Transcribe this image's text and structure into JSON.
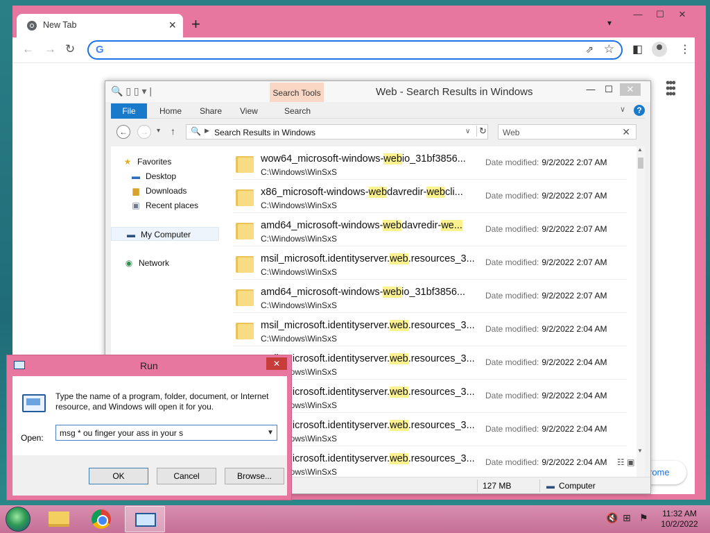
{
  "chrome": {
    "tab_title": "New Tab",
    "new_tab_symbol": "+",
    "customize_label": "rome",
    "omnibox_value": "",
    "icons": [
      "back-icon",
      "forward-icon",
      "reload-icon",
      "google-g-icon",
      "share-icon",
      "star-icon",
      "side-panel-icon",
      "profile-icon",
      "menu-icon",
      "apps-grid-icon"
    ]
  },
  "explorer": {
    "title": "Web - Search Results in Windows",
    "context_tab": "Search Tools",
    "ribbon_tabs": [
      "File",
      "Home",
      "Share",
      "View",
      "Search"
    ],
    "address_path": "Search Results in Windows",
    "search_value": "Web",
    "nav": {
      "favorites": "Favorites",
      "desktop": "Desktop",
      "downloads": "Downloads",
      "recent": "Recent places",
      "computer": "My Computer",
      "network": "Network"
    },
    "date_label": "Date modified:",
    "results": [
      {
        "pre": "wow64_microsoft-windows-",
        "hl": "web",
        "post": "io_31bf3856...",
        "hl2": "",
        "post2": "",
        "loc": "C:\\Windows\\WinSxS",
        "date": "9/2/2022 2:07 AM"
      },
      {
        "pre": "x86_microsoft-windows-",
        "hl": "web",
        "post": "davredir-",
        "hl2": "web",
        "post2": "cli...",
        "loc": "C:\\Windows\\WinSxS",
        "date": "9/2/2022 2:07 AM"
      },
      {
        "pre": "amd64_microsoft-windows-",
        "hl": "web",
        "post": "davredir-",
        "hl2": "we...",
        "post2": "",
        "loc": "C:\\Windows\\WinSxS",
        "date": "9/2/2022 2:07 AM"
      },
      {
        "pre": "msil_microsoft.identityserver.",
        "hl": "web",
        "post": ".resources_3...",
        "hl2": "",
        "post2": "",
        "loc": "C:\\Windows\\WinSxS",
        "date": "9/2/2022 2:07 AM"
      },
      {
        "pre": "amd64_microsoft-windows-",
        "hl": "web",
        "post": "io_31bf3856...",
        "hl2": "",
        "post2": "",
        "loc": "C:\\Windows\\WinSxS",
        "date": "9/2/2022 2:07 AM"
      },
      {
        "pre": "msil_microsoft.identityserver.",
        "hl": "web",
        "post": ".resources_3...",
        "hl2": "",
        "post2": "",
        "loc": "C:\\Windows\\WinSxS",
        "date": "9/2/2022 2:04 AM"
      },
      {
        "pre": "msil_microsoft.identityserver.",
        "hl": "web",
        "post": ".resources_3...",
        "hl2": "",
        "post2": "",
        "loc": "C:\\Windows\\WinSxS",
        "date": "9/2/2022 2:04 AM"
      },
      {
        "pre": "msil_microsoft.identityserver.",
        "hl": "web",
        "post": ".resources_3...",
        "hl2": "",
        "post2": "",
        "loc": "C:\\Windows\\WinSxS",
        "date": "9/2/2022 2:04 AM"
      },
      {
        "pre": "msil_microsoft.identityserver.",
        "hl": "web",
        "post": ".resources_3...",
        "hl2": "",
        "post2": "",
        "loc": "C:\\Windows\\WinSxS",
        "date": "9/2/2022 2:04 AM"
      },
      {
        "pre": "msil_microsoft.identityserver.",
        "hl": "web",
        "post": ".resources_3...",
        "hl2": "",
        "post2": "",
        "loc": "C:\\Windows\\WinSxS",
        "date": "9/2/2022 2:04 AM"
      }
    ],
    "status_size": "127 MB",
    "status_location": "Computer"
  },
  "run": {
    "title": "Run",
    "description": "Type the name of a program, folder, document, or Internet resource, and Windows will open it for you.",
    "open_label": "Open:",
    "open_value": "msg * ou finger your ass in your s",
    "ok_label": "OK",
    "cancel_label": "Cancel",
    "browse_label": "Browse..."
  },
  "taskbar": {
    "time": "11:32 AM",
    "date": "10/2/2022",
    "apps": [
      "file-explorer",
      "google-chrome",
      "run"
    ],
    "tray_icons": [
      "volume-muted-icon",
      "network-icon",
      "action-center-icon"
    ]
  },
  "colors": {
    "window_frame": "#e8779f",
    "accent_blue": "#1979ca",
    "search_highlight": "#fbf28d",
    "context_tab": "#f9d7c4",
    "desktop": "#2a7f86"
  }
}
